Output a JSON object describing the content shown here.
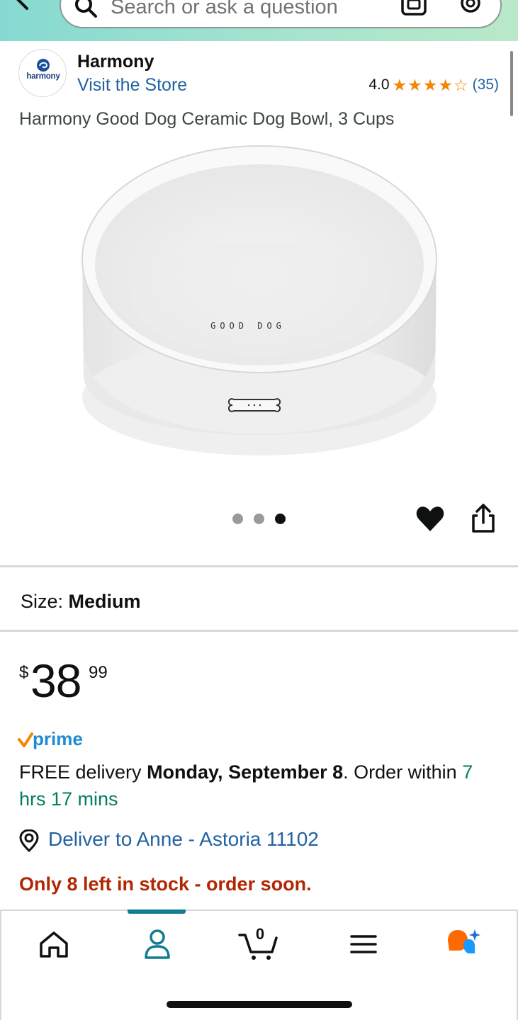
{
  "header": {
    "search_placeholder": "Search or ask a question"
  },
  "brand": {
    "logo_text": "harmony",
    "name": "Harmony",
    "visit_store": "Visit the Store",
    "rating": "4.0",
    "rating_value": 4.0,
    "rating_max": 5,
    "rating_count": "(35)"
  },
  "product": {
    "title": "Harmony Good Dog Ceramic Dog Bowl, 3 Cups",
    "bowl_text": "GOOD DOG",
    "image_dots": 3,
    "active_dot": 3
  },
  "size": {
    "label": "Size:",
    "value": "Medium"
  },
  "price": {
    "symbol": "$",
    "whole": "38",
    "fraction": "99"
  },
  "prime": {
    "label": "prime"
  },
  "delivery": {
    "prefix": "FREE delivery ",
    "date": "Monday, September 8",
    "mid": ". Order within ",
    "countdown": "7 hrs 17 mins",
    "deliver_to": "Deliver to Anne - Astoria 11102"
  },
  "stock": {
    "message": "Only 8 left in stock - order soon."
  },
  "bottom_nav": {
    "cart_count": "0",
    "active": "account"
  },
  "colors": {
    "link": "#2162a1",
    "stock_red": "#b12704",
    "countdown_green": "#067d62",
    "star": "#f08804",
    "nav_active": "#0f7c90"
  }
}
